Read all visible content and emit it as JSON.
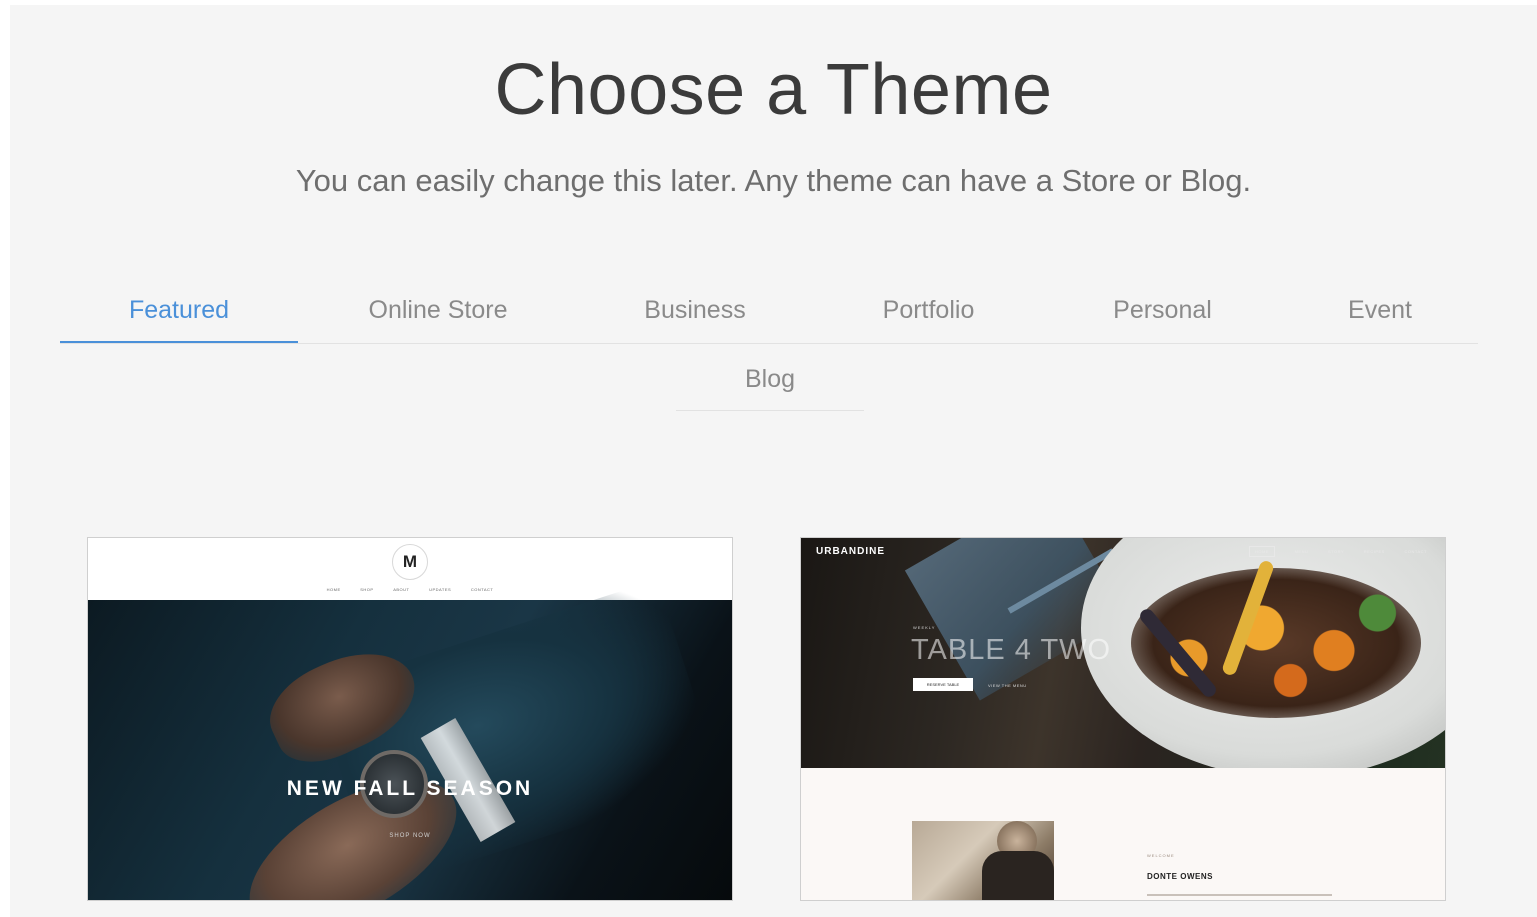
{
  "page": {
    "title": "Choose a Theme",
    "subtitle": "You can easily change this later. Any theme can have a Store or Blog."
  },
  "tabs": [
    {
      "label": "Featured",
      "active": true
    },
    {
      "label": "Online Store",
      "active": false
    },
    {
      "label": "Business",
      "active": false
    },
    {
      "label": "Portfolio",
      "active": false
    },
    {
      "label": "Personal",
      "active": false
    },
    {
      "label": "Event",
      "active": false
    },
    {
      "label": "Blog",
      "active": false
    }
  ],
  "accent_color": "#4a90d9",
  "themes": [
    {
      "logo_letter": "M",
      "nav": [
        "HOME",
        "SHOP",
        "ABOUT",
        "UPDATES",
        "CONTACT"
      ],
      "headline": "NEW FALL SEASON",
      "cta": "SHOP NOW"
    },
    {
      "brand": "URBANDINE",
      "nav": [
        "HOME",
        "MENU",
        "STORY",
        "RECIPES",
        "CONTACT"
      ],
      "kicker": "WEEKLY",
      "headline": "TABLE 4 TWO",
      "button": "RESERVE TABLE",
      "secondary_link": "VIEW THE MENU",
      "section_kicker": "WELCOME",
      "person_name": "DONTE OWENS"
    }
  ]
}
